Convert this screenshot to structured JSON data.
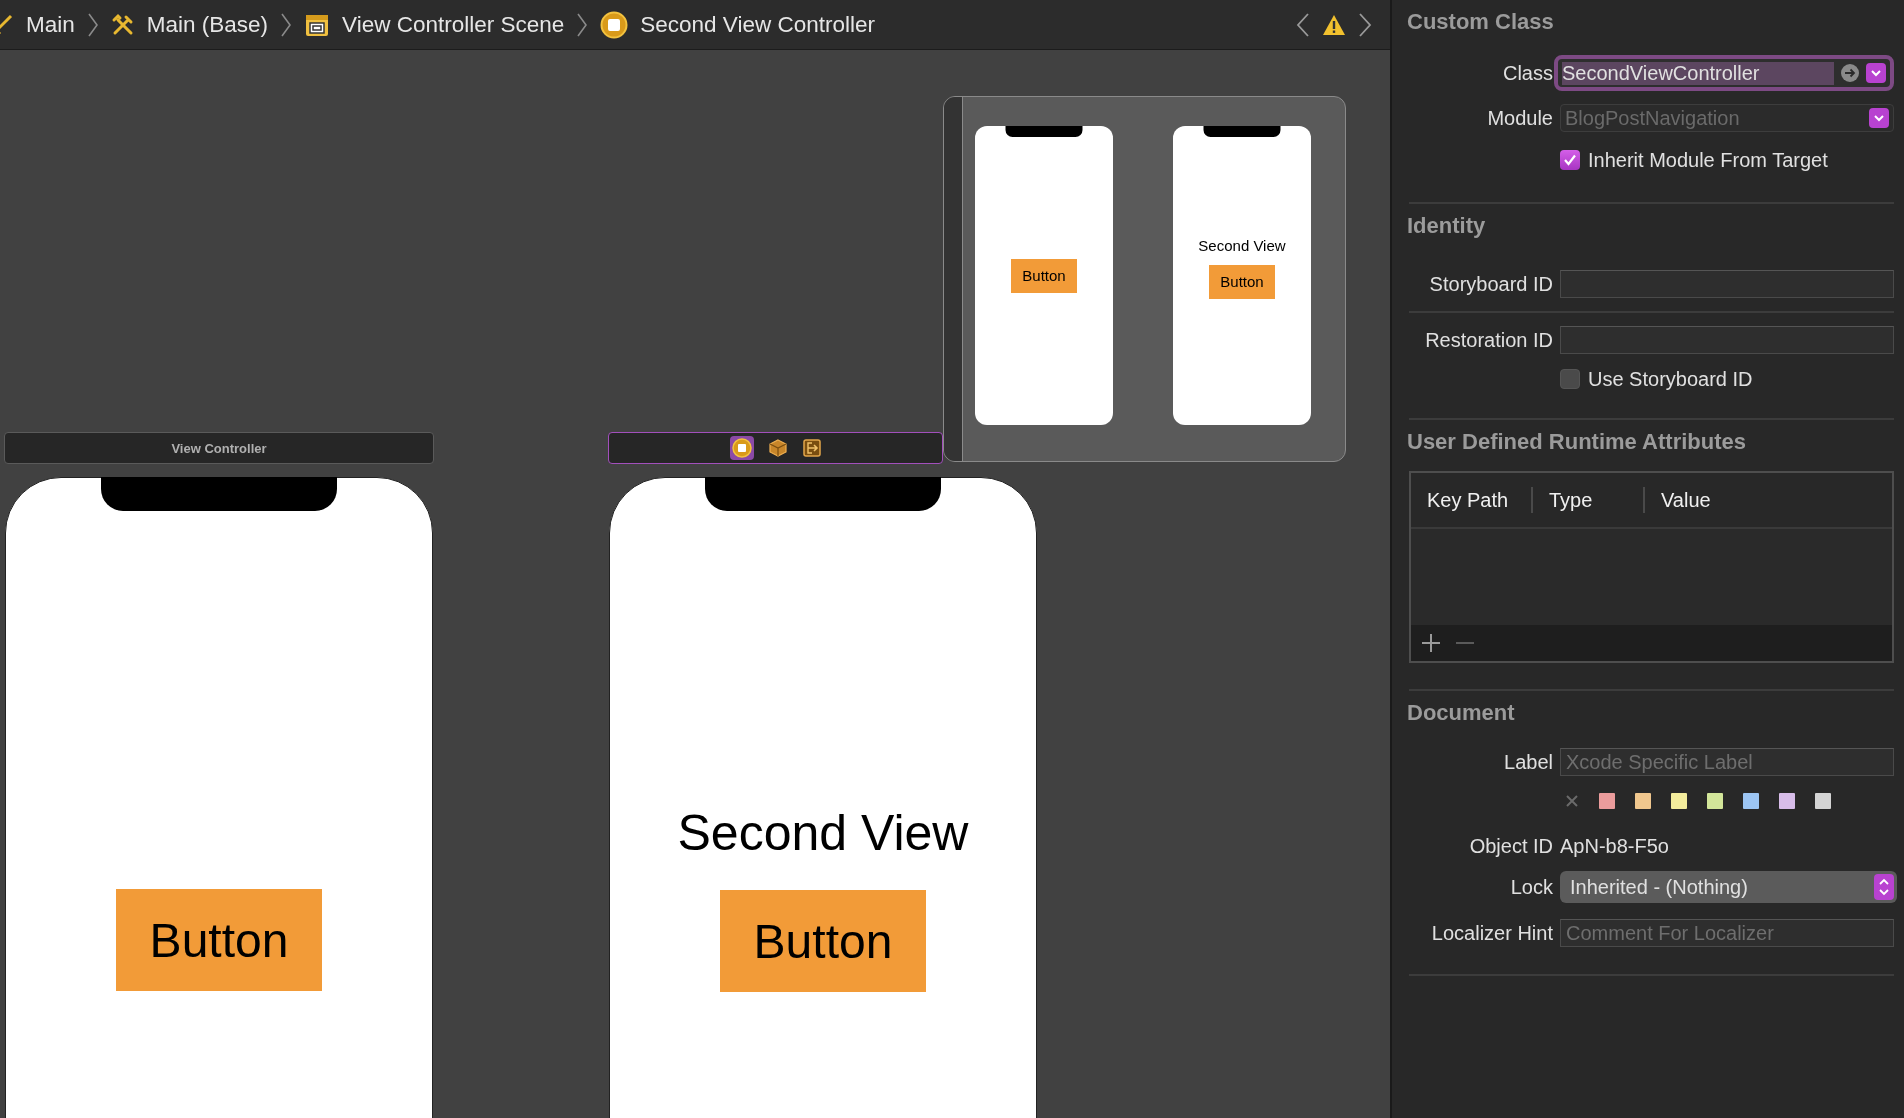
{
  "breadcrumbs": [
    {
      "label": "Main",
      "kind": "storyboard"
    },
    {
      "label": "Main (Base)",
      "kind": "base"
    },
    {
      "label": "View Controller Scene",
      "kind": "scene"
    },
    {
      "label": "Second View Controller",
      "kind": "controller"
    }
  ],
  "canvas": {
    "scenes": [
      {
        "title": "View Controller",
        "selected": false,
        "button": "Button"
      },
      {
        "selected": true,
        "text": "Second View",
        "button": "Button"
      }
    ]
  },
  "minimap": {
    "scenes": [
      {
        "button": "Button"
      },
      {
        "text": "Second View",
        "button": "Button"
      }
    ]
  },
  "inspector": {
    "custom_class": {
      "title": "Custom Class",
      "class": {
        "label": "Class",
        "value": "SecondViewController",
        "focused": true
      },
      "module": {
        "label": "Module",
        "placeholder": "BlogPostNavigation"
      },
      "inherit": {
        "label": "Inherit Module From Target",
        "checked": true
      }
    },
    "identity": {
      "title": "Identity",
      "storyboard_id": {
        "label": "Storyboard ID"
      },
      "restoration_id": {
        "label": "Restoration ID"
      },
      "use_storyboard_id": {
        "label": "Use Storyboard ID",
        "checked": false
      }
    },
    "runtime_attributes": {
      "title": "User Defined Runtime Attributes",
      "columns": [
        "Key Path",
        "Type",
        "Value"
      ]
    },
    "document": {
      "title": "Document",
      "label": {
        "label": "Label",
        "placeholder": "Xcode Specific Label"
      },
      "colors": [
        {
          "color": "#eb9c9c"
        },
        {
          "color": "#f0c78e"
        },
        {
          "color": "#f3ec9c"
        },
        {
          "color": "#d3e69a"
        },
        {
          "color": "#9cc5f3"
        },
        {
          "color": "#d8bde9"
        },
        {
          "color": "#d4d4d4"
        }
      ],
      "object_id": {
        "label": "Object ID",
        "value": "ApN-b8-F5o"
      },
      "lock": {
        "label": "Lock",
        "value": "Inherited - (Nothing)"
      },
      "localizer_hint": {
        "label": "Localizer Hint",
        "placeholder": "Comment For Localizer"
      }
    }
  }
}
